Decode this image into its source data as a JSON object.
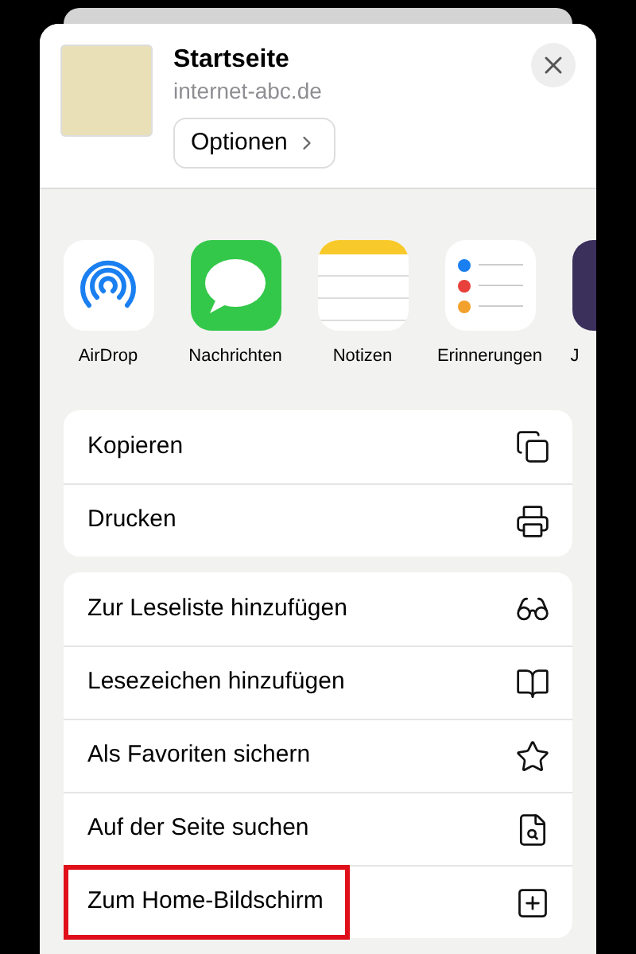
{
  "header": {
    "title": "Startseite",
    "subtitle": "internet-abc.de",
    "options_button": "Optionen"
  },
  "apps": [
    {
      "label": "AirDrop"
    },
    {
      "label": "Nachrichten"
    },
    {
      "label": "Notizen"
    },
    {
      "label": "Erinnerungen"
    },
    {
      "label": "J"
    }
  ],
  "action_groups": [
    [
      {
        "label": "Kopieren",
        "highlighted": false
      },
      {
        "label": "Drucken",
        "highlighted": false
      }
    ],
    [
      {
        "label": "Zur Leseliste hinzufügen",
        "highlighted": false
      },
      {
        "label": "Lesezeichen hinzufügen",
        "highlighted": false
      },
      {
        "label": "Als Favoriten sichern",
        "highlighted": false
      },
      {
        "label": "Auf der Seite suchen",
        "highlighted": false
      },
      {
        "label": "Zum Home-Bildschirm",
        "highlighted": true
      }
    ]
  ]
}
